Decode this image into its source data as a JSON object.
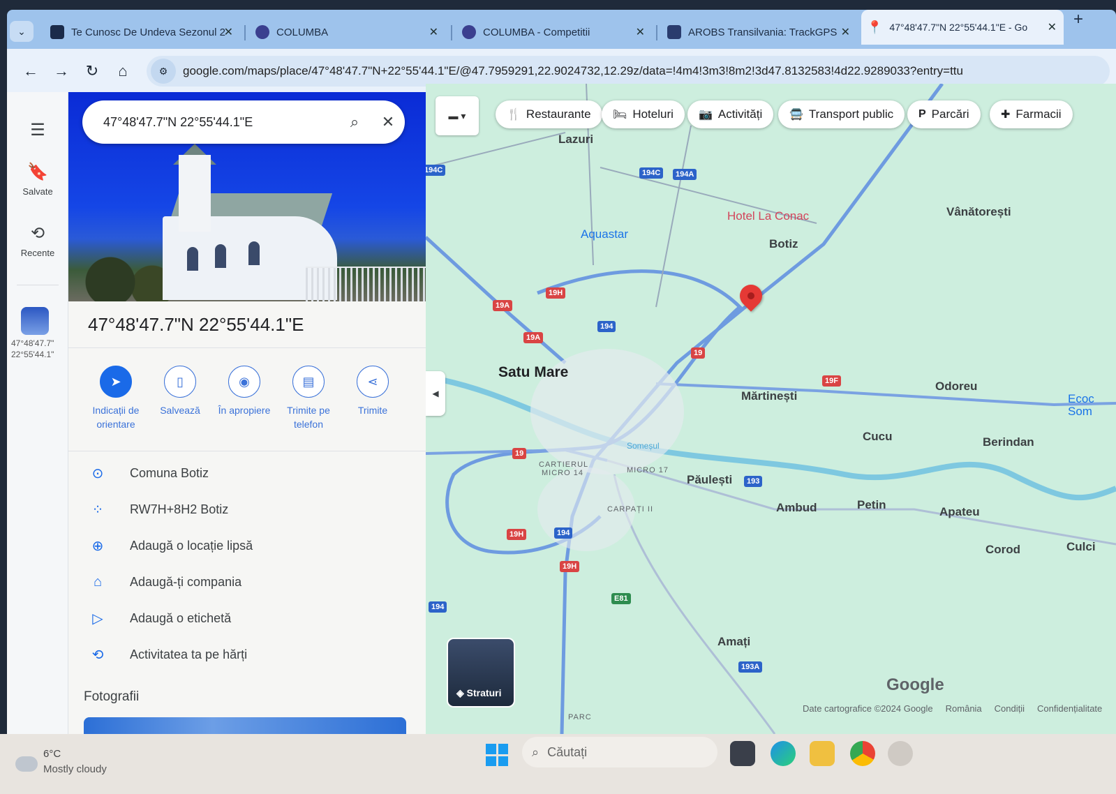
{
  "browser": {
    "tabs": [
      {
        "title": "Te Cunosc De Undeva Sezonul 2",
        "active": false
      },
      {
        "title": "COLUMBA",
        "active": false
      },
      {
        "title": "COLUMBA - Competitii",
        "active": false
      },
      {
        "title": "AROBS Transilvania: TrackGPS",
        "active": false
      },
      {
        "title": "47°48'47.7\"N 22°55'44.1\"E - Go",
        "active": true
      }
    ],
    "url": "google.com/maps/place/47°48'47.7\"N+22°55'44.1\"E/@47.7959291,22.9024732,12.29z/data=!4m4!3m3!8m2!3d47.8132583!4d22.9289033?entry=ttu"
  },
  "rail": {
    "saved_label": "Salvate",
    "recent_label": "Recente",
    "recent_coords_line1": "47°48'47.7\"",
    "recent_coords_line2": "22°55'44.1\""
  },
  "search": {
    "query": "47°48'47.7\"N 22°55'44.1\"E"
  },
  "place": {
    "title": "47°48'47.7\"N 22°55'44.1\"E",
    "actions": [
      {
        "label": "Indicații de orientare",
        "icon": "directions-icon"
      },
      {
        "label": "Salvează",
        "icon": "bookmark-icon"
      },
      {
        "label": "În apropiere",
        "icon": "nearby-icon"
      },
      {
        "label": "Trimite pe telefon",
        "icon": "send-to-phone-icon"
      },
      {
        "label": "Trimite",
        "icon": "share-icon"
      }
    ],
    "info": [
      {
        "text": "Comuna Botiz",
        "icon": "location-pin-icon"
      },
      {
        "text": "RW7H+8H2 Botiz",
        "icon": "plus-code-icon"
      },
      {
        "text": "Adaugă o locație lipsă",
        "icon": "add-location-icon"
      },
      {
        "text": "Adaugă-ți compania",
        "icon": "add-business-icon"
      },
      {
        "text": "Adaugă o etichetă",
        "icon": "label-icon"
      },
      {
        "text": "Activitatea ta pe hărți",
        "icon": "history-icon"
      }
    ],
    "photos_heading": "Fotografii"
  },
  "map": {
    "chips": [
      "Restaurante",
      "Hoteluri",
      "Activități",
      "Transport public",
      "Parcări",
      "Farmacii"
    ],
    "places": {
      "lazuri": "Lazuri",
      "hotel": "Hotel La Conac",
      "vanatoresti": "Vânătorești",
      "aquastar": "Aquastar",
      "botiz": "Botiz",
      "satu_mare": "Satu Mare",
      "martinesti": "Mărtinești",
      "odoreu": "Odoreu",
      "ecoc": "Ecoc",
      "som": "Som",
      "cucu": "Cucu",
      "berindan": "Berindan",
      "somesul": "Someșul",
      "cartierul": "CARTIERUL",
      "micro14": "MICRO 14",
      "micro17": "MICRO 17",
      "paulesti": "Păulești",
      "carpati": "CARPAȚI II",
      "ambud": "Ambud",
      "petin": "Petin",
      "apateu": "Apateu",
      "corod": "Corod",
      "culci": "Culci",
      "amati": "Amați",
      "parc": "PARC"
    },
    "shields": {
      "s194c_left": "194C",
      "s194c": "194C",
      "s194a": "194A",
      "s19h_a": "19H",
      "s19a_a": "19A",
      "s194_a": "194",
      "s19a_b": "19A",
      "s19": "19",
      "s19f": "19F",
      "s19_b": "19",
      "s193": "193",
      "s19h_b": "19H",
      "s194_b": "194",
      "s19h_c": "19H",
      "se81": "E81",
      "s194_c": "194",
      "s193a": "193A"
    },
    "layers_label": "Straturi",
    "logo": "Google",
    "footer": [
      "Date cartografice ©2024 Google",
      "România",
      "Condiții",
      "Confidențialitate"
    ]
  },
  "taskbar": {
    "temperature": "6°C",
    "weather": "Mostly cloudy",
    "search_placeholder": "Căutați"
  }
}
